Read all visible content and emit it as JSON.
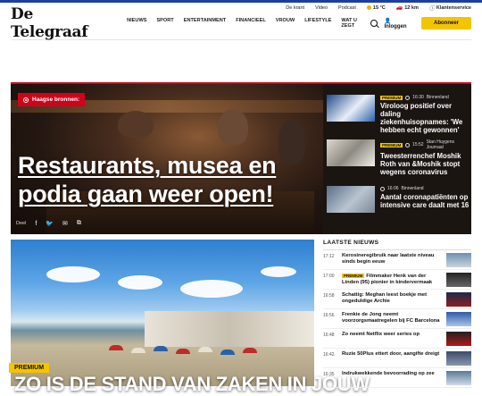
{
  "util": {
    "de_krant": "De krant",
    "video": "Video",
    "podcast": "Podcast",
    "weather": "15 °C",
    "traffic": "12 km",
    "service": "Klantenservice"
  },
  "header": {
    "logo": "De Telegraaf",
    "nav": [
      "NIEUWS",
      "SPORT",
      "ENTERTAINMENT",
      "FINANCIEEL",
      "VROUW",
      "LIFESTYLE",
      "WAT U ZEGT"
    ],
    "login": "Inloggen",
    "subscribe": "Abonneer"
  },
  "hero": {
    "badge": "Haagse bronnen:",
    "title": "Restaurants, musea en podia gaan weer open!",
    "share_label": "Deel"
  },
  "side_items": [
    {
      "premium": "PREMIUM",
      "time": "16:30",
      "section": "Binnenland",
      "title": "Viroloog positief over daling ziekenhuisopnames: 'We hebben echt gewonnen'"
    },
    {
      "premium": "PREMIUM",
      "time": "15:52",
      "section": "Stan Huygens Journaal",
      "title": "Tweesterrenchef Moshik Roth van &Moshik stopt wegens coronavirus"
    },
    {
      "premium": "",
      "time": "16:06",
      "section": "Binnenland",
      "title": "Aantal coronapatiënten op intensive care daalt met 16"
    }
  ],
  "lower": {
    "premium": "PREMIUM",
    "title": "ZO IS DE STAND VAN ZAKEN IN JOUW"
  },
  "latest": {
    "heading": "LAATSTE NIEUWS",
    "items": [
      {
        "time": "17:12",
        "premium": "",
        "text": "Kerosineregibruik naar laatste niveau sinds begin eeuw"
      },
      {
        "time": "17:00",
        "premium": "PREMIUM",
        "text": "Filmmaker Henk van der Linden (95) pionier in kindervermaak"
      },
      {
        "time": "16:58",
        "premium": "",
        "text": "Schattig: Meghan leest boekje met ongeduldige Archie"
      },
      {
        "time": "16:56",
        "premium": "",
        "text": "Frenkie de Jong neemt voorzorgsmaatregelen bij FC Barcelona"
      },
      {
        "time": "16:48",
        "premium": "",
        "text": "Zo neemt Netflix weer series op"
      },
      {
        "time": "16:42",
        "premium": "",
        "text": "Ruzie 50Plus ettert door, aangifte dreigt"
      },
      {
        "time": "16:35",
        "premium": "",
        "text": "Indrukwekkende bevoorrading op zee"
      }
    ]
  },
  "colors": {
    "accent_red": "#d0021b",
    "premium_yellow": "#f5c400",
    "brand_blue": "#1a3fa0"
  }
}
